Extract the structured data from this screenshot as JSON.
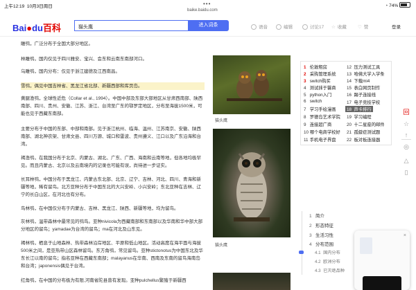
{
  "status": {
    "time": "上午12:19",
    "date": "10月3日周日",
    "battery": "74%"
  },
  "url": "baike.baidu.com",
  "header": {
    "logo_left": "Bai",
    "logo_mid": "du",
    "logo_right": "百科",
    "search_value": "猫头鹰",
    "search_button": "进入词条",
    "actions": [
      "语音",
      "编辑",
      "讨论",
      "收藏",
      "赞"
    ],
    "discuss_count": "17",
    "login": "登录"
  },
  "article": {
    "paragraphs": [
      "雕鸮，广泛分布于全国大部分地区。",
      "林雕鸮，国内仅见于四川雅安、宝兴、会东和云南东南部河口。",
      "乌雕鸮，国内分布：仅见于浙江建德及江西南昌。",
      "雪鸮，偶见中国吉林省、黑龙江省北部、新疆西部和库页岛。",
      "黄腿渔鸮，全球性近危（Collar et al., 1994）。中国中部及东部大部地区从甘肃西南部、陕西南部、四川、贵州、安徽、江苏、浙江、台湾至广东的鄂罗定地区，分布至海拔1500米，可能也见于西藏东南部。",
      "主要分布于中国的东部、中部和南部。见于浙江杭州、临海、温州、江苏南京、安徽、陕西南部、湖北神农架、甘肃文县、四川万源、城口和雷波、贵州遵义、江口以及广东沿海和台湾。",
      "褐渔鸮，在我国分布于北京、内蒙古、湖北、广东、广西、海南和云南等地，但各地均极罕见。而且内蒙古、北京以及云南境内的记录也可能有误，尚待进一步证实。",
      "长耳林鸮，中国分布于黑龙江、内蒙古东北部、北京、辽宁、吉林、河北、四川、青海和新疆等地，稀有留鸟。北方亚种分布于中国东北的大兴安岭、小兴安岭；东北亚种在吉林、辽宁的长白山区，在河北也有分布。",
      "鸟林鸮，在中国仅分布于内蒙古、吉林、黑龙江、陕西、新疆等地，均为留鸟。",
      "灰林鸮，温带森林中最常见的鸮鸟。亚种nivicola为西藏南部和东南部以及华南和华中部大部分地区的留鸟；yamadae为台湾的留鸟；ma在河北及山东见。",
      "褐林鸮，栖息于山地森林、热带森林沿岸地区、平原和低山地区。活动高度在海平面与海拔500米之间，是亚热带山区森林留鸟。东方角鸮，常见留鸟。亚种stictonotus为中国东北及华东长江以南的留鸟；指名亚种在西藏东南部；malayanus在华南、西南及东南的留鸟海南岛和台湾；japonensis偶见于台湾。",
      "红角鸮，在中国的分布极为有限,河南省陀县曾有发现。亚种pulchellus繁殖于新疆西"
    ],
    "captions": [
      "猫头鹰",
      "猫头鹰"
    ]
  },
  "hot_list": [
    {
      "n": "1",
      "t": "伦敦租房",
      "red": true
    },
    {
      "n": "2",
      "t": "采购管理系统",
      "red": true
    },
    {
      "n": "3",
      "t": "switch购买",
      "red": true
    },
    {
      "n": "4",
      "t": "测试抹于醫商",
      "red": false
    },
    {
      "n": "5",
      "t": "python入门",
      "red": false
    },
    {
      "n": "6",
      "t": "switch",
      "red": false
    },
    {
      "n": "7",
      "t": "学习手绘漫画",
      "red": false
    },
    {
      "n": "8",
      "t": "罗德岛艺术学院",
      "red": false
    },
    {
      "n": "9",
      "t": "连接超广商",
      "red": false
    },
    {
      "n": "10",
      "t": "哪个电商学校好",
      "red": false
    },
    {
      "n": "11",
      "t": "手机电子界盘",
      "red": false
    },
    {
      "n": "12",
      "t": "压力测试工具",
      "red": false
    },
    {
      "n": "13",
      "t": "哈佛大学入学条",
      "red": false
    },
    {
      "n": "14",
      "t": "下载mi4",
      "red": false
    },
    {
      "n": "15",
      "t": "表白网页制作",
      "red": false
    },
    {
      "n": "16",
      "t": "踢子连接线",
      "red": false
    },
    {
      "n": "17",
      "t": "电子竞技学校",
      "red": false
    },
    {
      "n": "18",
      "t": "声卡排行",
      "red": false
    },
    {
      "n": "19",
      "t": "学习编程",
      "red": false
    },
    {
      "n": "20",
      "t": "十二星座的邮件",
      "red": false
    },
    {
      "n": "21",
      "t": "孤僻症测试题",
      "red": false
    },
    {
      "n": "22",
      "t": "板对板连接器",
      "red": false
    }
  ],
  "toc": {
    "items": [
      {
        "n": "1",
        "t": "简介"
      },
      {
        "n": "2",
        "t": "形态特征"
      },
      {
        "n": "3",
        "t": "生活习性"
      },
      {
        "n": "4",
        "t": "分布范围"
      }
    ],
    "subs": [
      {
        "n": "4.1",
        "t": "国内分布"
      },
      {
        "n": "4.2",
        "t": "欧洲分布"
      },
      {
        "n": "4.3",
        "t": "已灭绝品种"
      }
    ]
  },
  "side_tools": [
    "回",
    "☆",
    "↑",
    "◎",
    "△",
    "▯"
  ],
  "colors": {
    "brand": "#2932e1",
    "accent": "#4e6ef2",
    "highlight": "#fbf3c9",
    "red": "#e10602"
  }
}
